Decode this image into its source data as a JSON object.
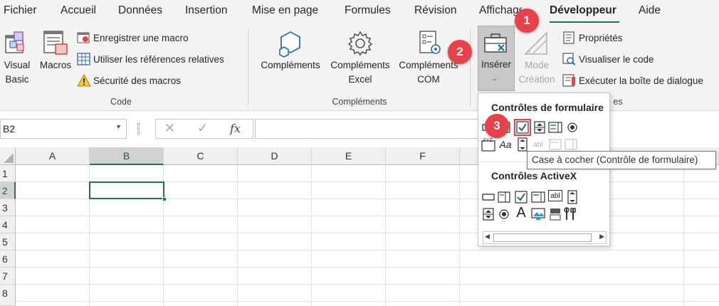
{
  "tabs": [
    "Fichier",
    "Accueil",
    "Données",
    "Insertion",
    "Mise en page",
    "Formules",
    "Révision",
    "Affichage",
    "Développeur",
    "Aide"
  ],
  "active_tab": "Développeur",
  "accent_color": "#217346",
  "badge_color": "#e7424a",
  "ribbon": {
    "code": {
      "label": "Code",
      "visual_basic": [
        "Visual",
        "Basic"
      ],
      "macros": "Macros",
      "record_macro": "Enregistrer une macro",
      "relative_refs": "Utiliser les références relatives",
      "macro_security": "Sécurité des macros"
    },
    "addins": {
      "label": "Compléments",
      "complements": "Compléments",
      "excel_addins": [
        "Compléments",
        "Excel"
      ],
      "com_addins": [
        "Compléments",
        "COM"
      ]
    },
    "controls": {
      "insert": "Insérer",
      "design_mode": [
        "Mode",
        "Création"
      ],
      "properties": "Propriétés",
      "view_code": "Visualiser le code",
      "run_dialog": "Exécuter la boîte de dialogue",
      "group_label_partial": "es"
    }
  },
  "badges": [
    "1",
    "2",
    "3"
  ],
  "formula_bar": {
    "name_box": "B2",
    "fx": "fx"
  },
  "grid": {
    "columns": [
      "A",
      "B",
      "C",
      "D",
      "E",
      "F"
    ],
    "rows": [
      "1",
      "2",
      "3",
      "4",
      "5",
      "6",
      "7",
      "8"
    ],
    "selected_column": "B",
    "selected_row": "2"
  },
  "dropdown": {
    "form_controls_title": "Contrôles de formulaire",
    "activex_title": "Contrôles ActiveX",
    "xyz_label": "XYZ",
    "aa_label": "Aa",
    "a_label": "A",
    "abl_label": "abl"
  },
  "tooltip": "Case à cocher (Contrôle de formulaire)"
}
